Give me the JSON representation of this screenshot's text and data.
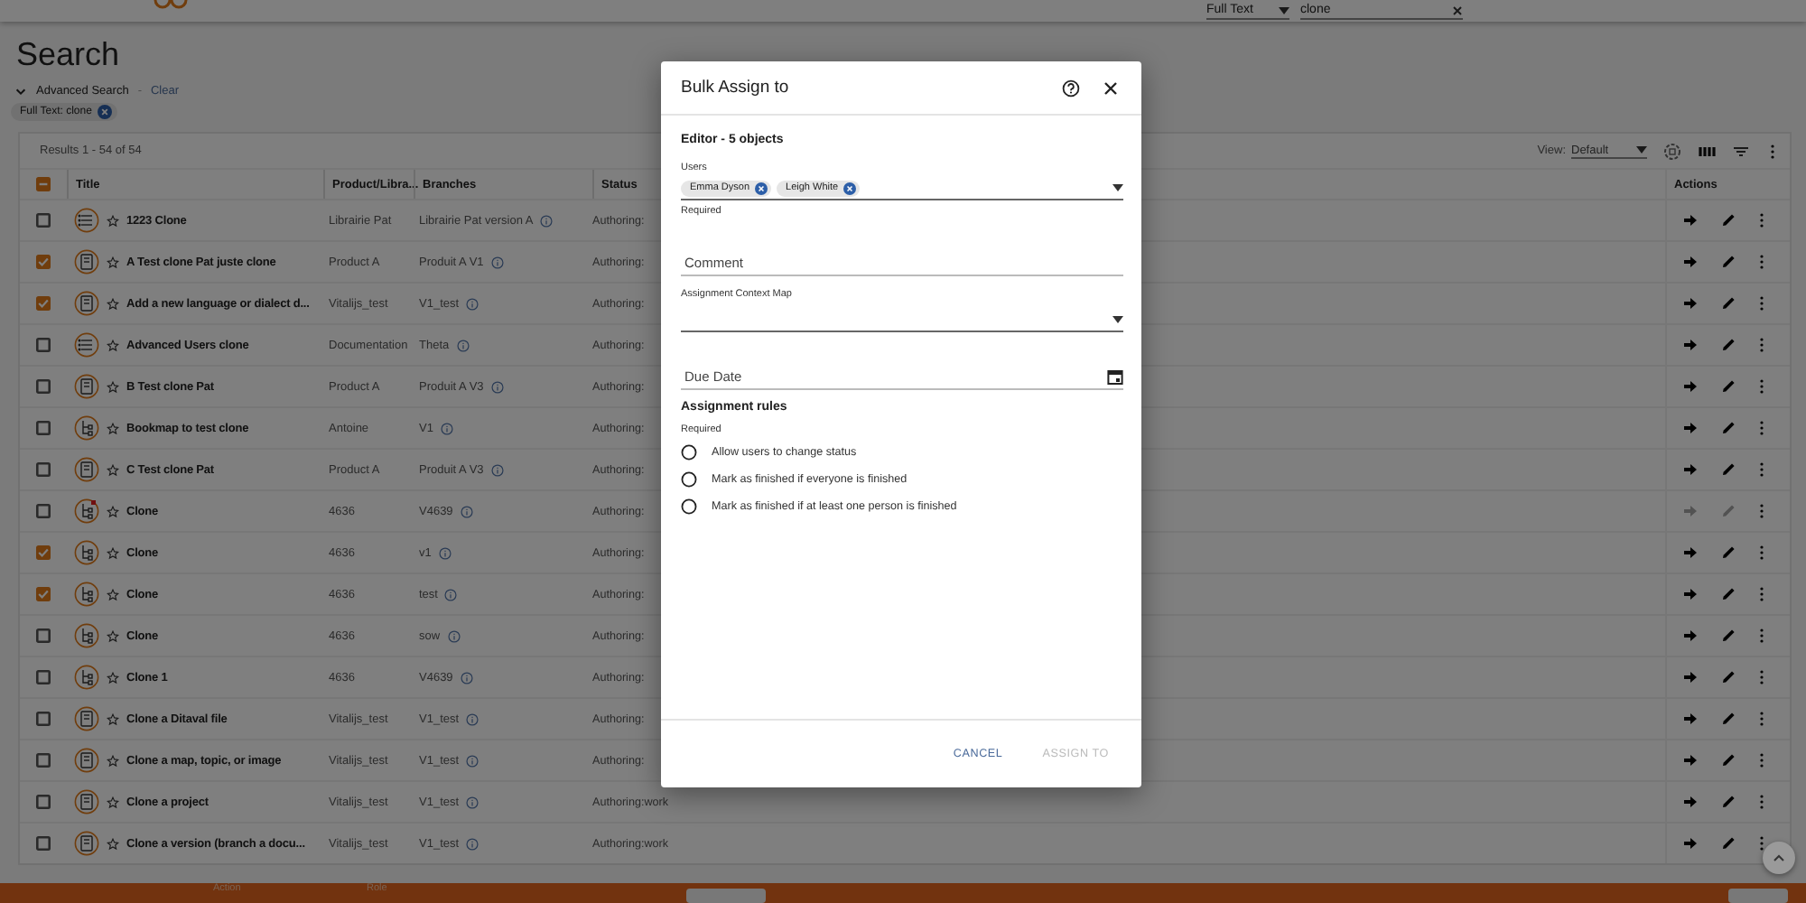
{
  "top_bar": {
    "search_scope": "Full Text",
    "search_value": "clone"
  },
  "page_title": "Search",
  "advanced_search": {
    "expanded": true,
    "label": "Advanced Search",
    "separator": "-",
    "clear": "Clear"
  },
  "filter_chips": [
    {
      "label": "Full Text: clone"
    }
  ],
  "table": {
    "results": "Results 1 - 54 of 54",
    "view_label": "View:",
    "view_value": "Default",
    "header_partial": true,
    "columns": [
      "Title",
      "Product/Libra...",
      "Branches",
      "Status",
      "Actions"
    ],
    "rows": [
      {
        "kind": "list",
        "title": "1223 Clone",
        "product": "Librairie Pat",
        "branch": "Librairie Pat version A",
        "status": "Authoring:",
        "checked": false,
        "flagged": false,
        "actions_disabled": false
      },
      {
        "kind": "document",
        "title": "A Test clone Pat juste clone",
        "product": "Product A",
        "branch": "Produit A V1",
        "status": "Authoring:",
        "checked": true,
        "flagged": false,
        "actions_disabled": false
      },
      {
        "kind": "document",
        "title": "Add a new language or dialect d...",
        "product": "Vitalijs_test",
        "branch": "V1_test",
        "status": "Authoring:",
        "checked": true,
        "flagged": false,
        "actions_disabled": false
      },
      {
        "kind": "list",
        "title": "Advanced Users clone",
        "product": "Documentation",
        "branch": "Theta",
        "status": "Authoring:",
        "checked": false,
        "flagged": false,
        "actions_disabled": false
      },
      {
        "kind": "document",
        "title": "B Test clone Pat",
        "product": "Product A",
        "branch": "Produit A V3",
        "status": "Authoring:",
        "checked": false,
        "flagged": false,
        "actions_disabled": false
      },
      {
        "kind": "map",
        "title": "Bookmap to test clone",
        "product": "Antoine",
        "branch": "V1",
        "status": "Authoring:",
        "checked": false,
        "flagged": false,
        "actions_disabled": false
      },
      {
        "kind": "document",
        "title": "C Test clone Pat",
        "product": "Product A",
        "branch": "Produit A V3",
        "status": "Authoring:",
        "checked": false,
        "flagged": false,
        "actions_disabled": false
      },
      {
        "kind": "map",
        "title": "Clone",
        "product": "4636",
        "branch": "V4639",
        "status": "Authoring:",
        "checked": false,
        "flagged": true,
        "actions_disabled": true
      },
      {
        "kind": "map",
        "title": "Clone",
        "product": "4636",
        "branch": "v1",
        "status": "Authoring:",
        "checked": true,
        "flagged": false,
        "actions_disabled": false
      },
      {
        "kind": "map",
        "title": "Clone",
        "product": "4636",
        "branch": "test",
        "status": "Authoring:",
        "checked": true,
        "flagged": false,
        "actions_disabled": false
      },
      {
        "kind": "map",
        "title": "Clone",
        "product": "4636",
        "branch": "sow",
        "status": "Authoring:",
        "checked": false,
        "flagged": false,
        "actions_disabled": false
      },
      {
        "kind": "map",
        "title": "Clone 1",
        "product": "4636",
        "branch": "V4639",
        "status": "Authoring:",
        "checked": false,
        "flagged": false,
        "actions_disabled": false
      },
      {
        "kind": "document",
        "title": "Clone a Ditaval file",
        "product": "Vitalijs_test",
        "branch": "V1_test",
        "status": "Authoring:",
        "checked": false,
        "flagged": false,
        "actions_disabled": false
      },
      {
        "kind": "document",
        "title": "Clone a map, topic, or image",
        "product": "Vitalijs_test",
        "branch": "V1_test",
        "status": "Authoring:",
        "checked": false,
        "flagged": false,
        "actions_disabled": false
      },
      {
        "kind": "document",
        "title": "Clone a project",
        "product": "Vitalijs_test",
        "branch": "V1_test",
        "status": "Authoring:work",
        "checked": false,
        "flagged": false,
        "actions_disabled": false
      },
      {
        "kind": "document",
        "title": "Clone a version (branch a docu...",
        "product": "Vitalijs_test",
        "branch": "V1_test",
        "status": "Authoring:work",
        "checked": false,
        "flagged": false,
        "actions_disabled": false
      }
    ]
  },
  "dialog": {
    "title": "Bulk Assign to",
    "subtitle": "Editor - 5 objects",
    "users": {
      "label": "Users",
      "chips": [
        "Emma Dyson",
        "Leigh White"
      ],
      "hint": "Required"
    },
    "comment": {
      "placeholder": "Comment"
    },
    "context_map": {
      "label": "Assignment Context Map"
    },
    "due_date": {
      "placeholder": "Due Date"
    },
    "rules": {
      "title": "Assignment rules",
      "hint": "Required",
      "options": [
        {
          "label": "Allow users to change status",
          "selected": false
        },
        {
          "label": "Mark as finished if everyone is finished",
          "selected": false
        },
        {
          "label": "Mark as finished if at least one person is finished",
          "selected": false
        }
      ]
    },
    "buttons": [
      {
        "label": "CANCEL",
        "disabled": false
      },
      {
        "label": "ASSIGN TO",
        "disabled": true
      }
    ]
  },
  "bottom_bar": {
    "labels": [
      "Action",
      "Role"
    ]
  }
}
